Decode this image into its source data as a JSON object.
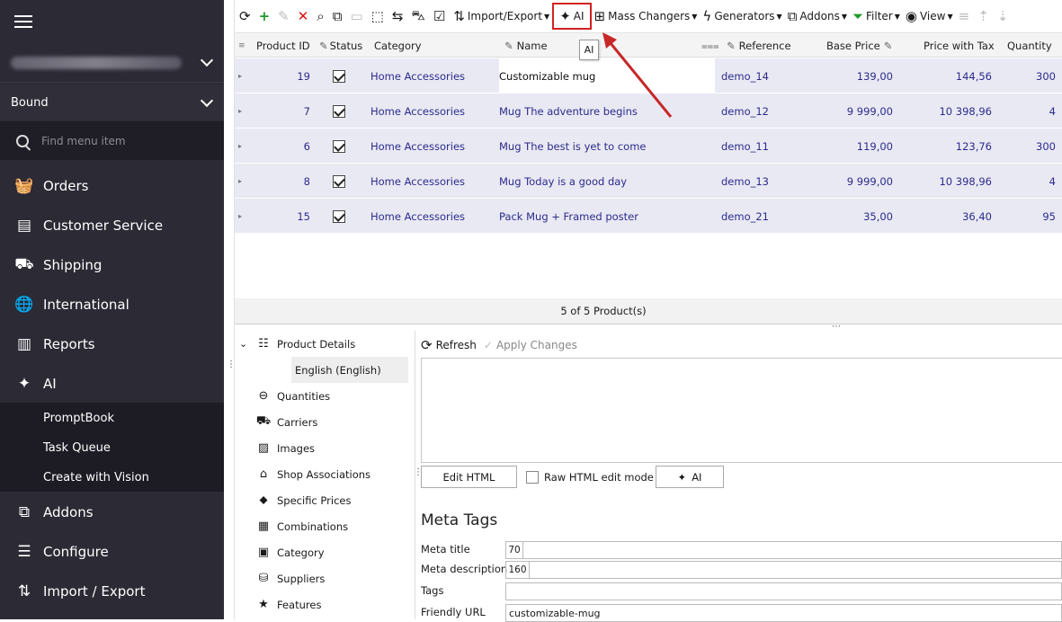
{
  "sidebar": {
    "store": "Bound",
    "search_placeholder": "Find menu item",
    "items": [
      {
        "label": "Orders",
        "icon": "basket-icon"
      },
      {
        "label": "Customer Service",
        "icon": "chat-icon"
      },
      {
        "label": "Shipping",
        "icon": "truck-icon"
      },
      {
        "label": "International",
        "icon": "globe-icon"
      },
      {
        "label": "Reports",
        "icon": "bar-chart-icon"
      },
      {
        "label": "AI",
        "icon": "sparkle-icon"
      }
    ],
    "sub_items": [
      "PromptBook",
      "Task Queue",
      "Create with Vision"
    ],
    "bottom_items": [
      {
        "label": "Addons",
        "icon": "puzzle-icon"
      },
      {
        "label": "Configure",
        "icon": "sliders-icon"
      },
      {
        "label": "Import / Export",
        "icon": "arrows-icon"
      }
    ]
  },
  "toolbar": {
    "import_export": "Import/Export",
    "ai": "AI",
    "mass_changers": "Mass Changers",
    "generators": "Generators",
    "addons": "Addons",
    "filter": "Filter",
    "view": "View",
    "tooltip": "AI"
  },
  "grid": {
    "columns": [
      "Product ID",
      "Status",
      "Category",
      "Name",
      "Reference",
      "Base Price",
      "Price with Tax",
      "Quantity"
    ],
    "rows": [
      {
        "id": "19",
        "category": "Home Accessories",
        "name": "Customizable mug",
        "ref": "demo_14",
        "base": "139,00",
        "tax": "144,56",
        "qty": "300"
      },
      {
        "id": "7",
        "category": "Home Accessories",
        "name": "Mug The adventure begins",
        "ref": "demo_12",
        "base": "9 999,00",
        "tax": "10 398,96",
        "qty": "4"
      },
      {
        "id": "6",
        "category": "Home Accessories",
        "name": "Mug The best is yet to come",
        "ref": "demo_11",
        "base": "119,00",
        "tax": "123,76",
        "qty": "300"
      },
      {
        "id": "8",
        "category": "Home Accessories",
        "name": "Mug Today is a good day",
        "ref": "demo_13",
        "base": "9 999,00",
        "tax": "10 398,96",
        "qty": "4"
      },
      {
        "id": "15",
        "category": "Home Accessories",
        "name": "Pack Mug + Framed poster",
        "ref": "demo_21",
        "base": "35,00",
        "tax": "36,40",
        "qty": "95"
      }
    ],
    "footer": "5 of 5 Product(s)"
  },
  "details": {
    "tree": [
      {
        "label": "Product Details",
        "icon": "list-icon"
      },
      {
        "label": "English (English)",
        "icon": ""
      },
      {
        "label": "Quantities",
        "icon": "quantities-icon"
      },
      {
        "label": "Carriers",
        "icon": "truck-icon"
      },
      {
        "label": "Images",
        "icon": "image-icon"
      },
      {
        "label": "Shop Associations",
        "icon": "shop-icon"
      },
      {
        "label": "Specific Prices",
        "icon": "tag-icon"
      },
      {
        "label": "Combinations",
        "icon": "grid-icon"
      },
      {
        "label": "Category",
        "icon": "folder-icon"
      },
      {
        "label": "Suppliers",
        "icon": "supplier-icon"
      },
      {
        "label": "Features",
        "icon": "star-icon"
      }
    ],
    "refresh": "Refresh",
    "apply": "Apply Changes",
    "edit_html": "Edit HTML",
    "raw_html": "Raw HTML edit mode",
    "ai_button": "AI",
    "meta_heading": "Meta Tags",
    "meta": [
      {
        "label": "Meta title",
        "count": "70",
        "value": ""
      },
      {
        "label": "Meta description",
        "count": "160",
        "value": ""
      },
      {
        "label": "Tags",
        "count": "",
        "value": ""
      },
      {
        "label": "Friendly URL",
        "count": "",
        "value": "customizable-mug"
      }
    ]
  }
}
